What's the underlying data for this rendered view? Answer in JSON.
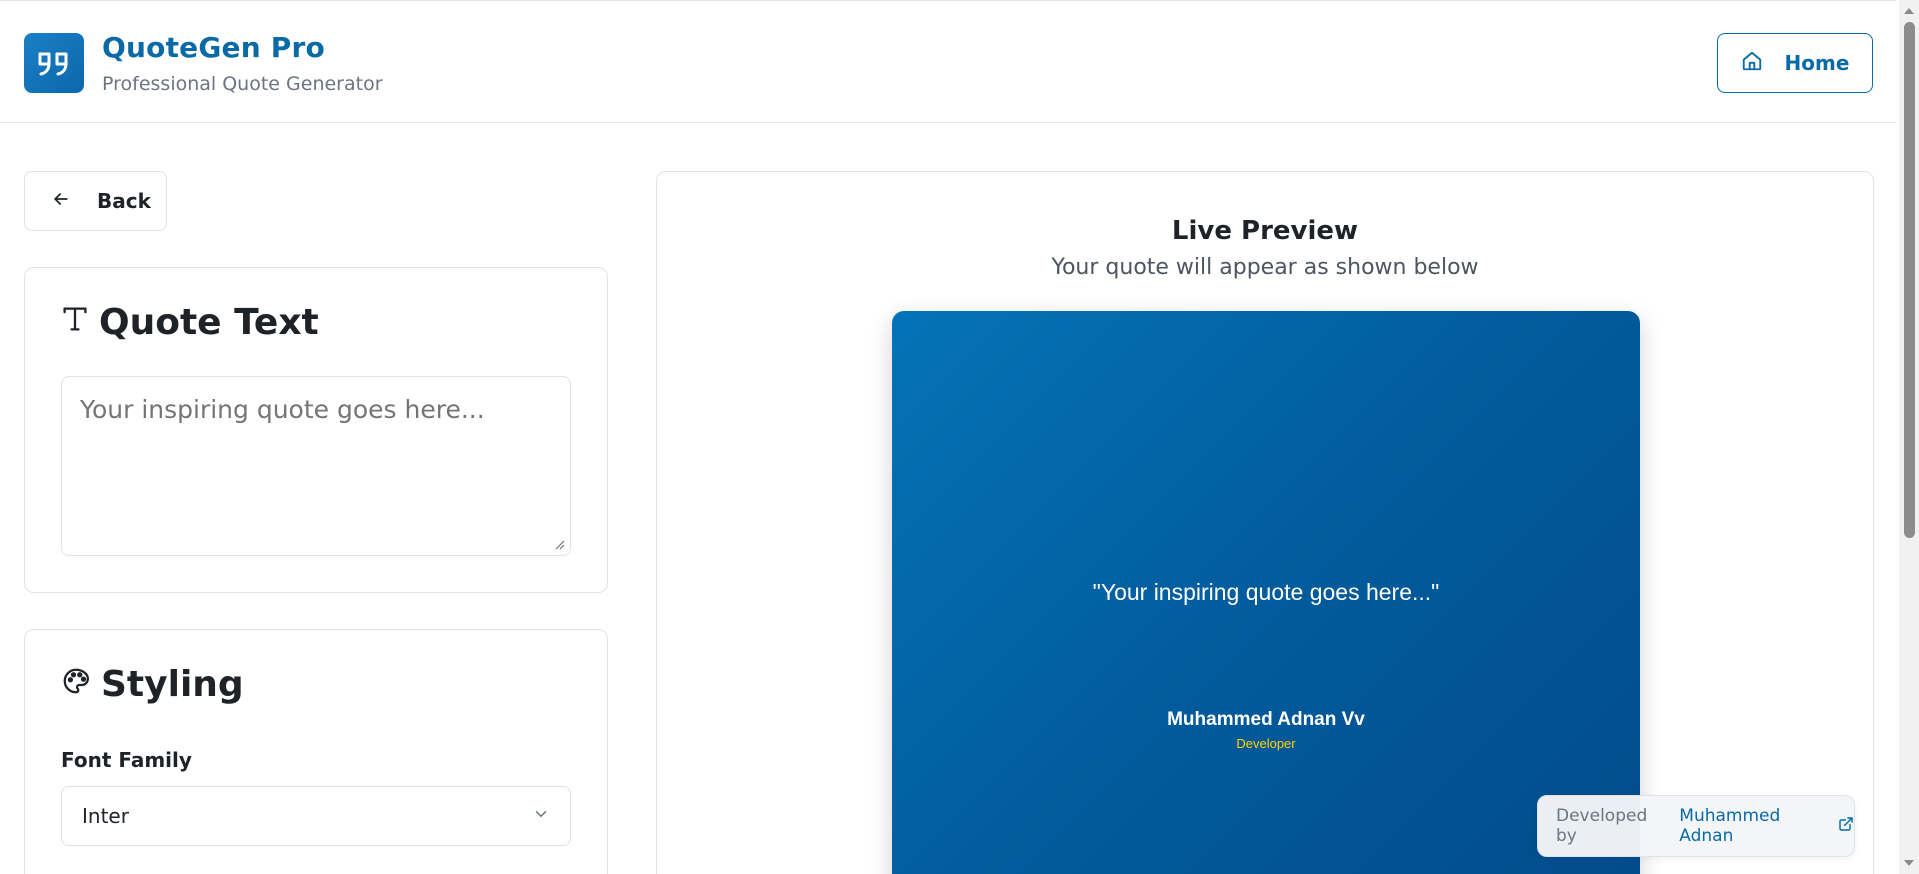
{
  "header": {
    "app_title": "QuoteGen Pro",
    "app_subtitle": "Professional Quote Generator",
    "logo_icon": "quote-marks-icon",
    "home_label": "Home"
  },
  "left": {
    "back_label": "Back",
    "quote_card": {
      "heading": "Quote Text",
      "textarea_placeholder": "Your inspiring quote goes here..."
    },
    "styling_card": {
      "heading": "Styling",
      "font_family_label": "Font Family",
      "font_family_value": "Inter"
    }
  },
  "preview": {
    "title": "Live Preview",
    "subtitle": "Your quote will appear as shown below",
    "quote_text": "\"Your inspiring quote goes here...\"",
    "author_name": "Muhammed Adnan Vv",
    "author_role": "Developer"
  },
  "footer_badge": {
    "label": "Developed by",
    "link_text": "Muhammed Adnan"
  },
  "colors": {
    "brand": "#0a6aa6",
    "canvas_gradient_start": "#0473b7",
    "canvas_gradient_end": "#024b8a",
    "role_color": "#ffd400"
  }
}
